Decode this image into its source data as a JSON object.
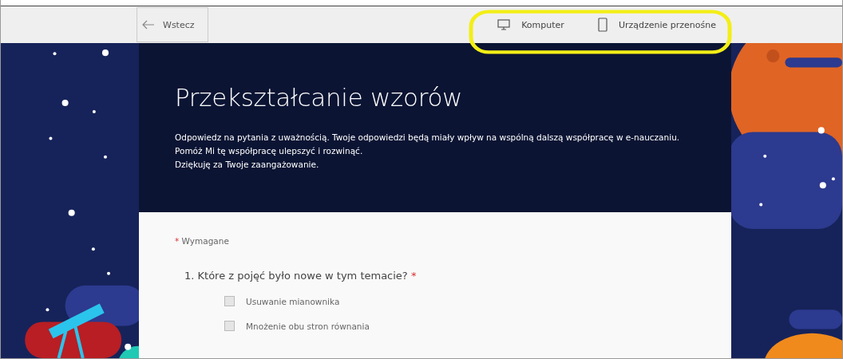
{
  "toolbar": {
    "back_button": "Wstecz",
    "preview_options": [
      {
        "label": "Komputer",
        "kind": "desktop"
      },
      {
        "label": "Urządzenie przenośne",
        "kind": "mobile"
      }
    ]
  },
  "form": {
    "title": "Przekształcanie wzorów",
    "description": "Odpowiedz na pytania z uważnością. Twoje odpowiedzi będą miały wpływ na wspólną dalszą współpracę w e-nauczaniu. Pomóż Mi tę współpracę ulepszyć i rozwinąć.",
    "thanks": "Dziękuję za Twoje zaangażowanie.",
    "required_note": "Wymagane",
    "required_mark": "*",
    "questions": [
      {
        "text": "1. Które z pojęć było nowe w tym temacie?",
        "required_mark": "*",
        "options": [
          {
            "label": "Usuwanie mianownika",
            "checked": false
          },
          {
            "label": "Mnożenie obu stron równania",
            "checked": false
          }
        ]
      }
    ]
  }
}
